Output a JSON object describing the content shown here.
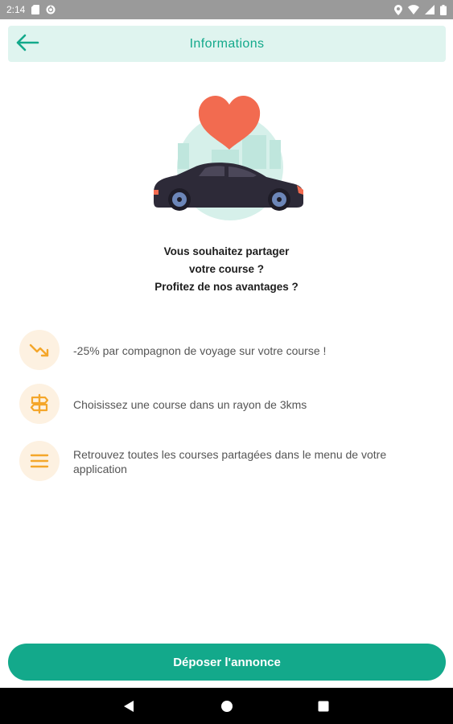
{
  "status_bar": {
    "time": "2:14",
    "left_icons": [
      "sd-card-icon",
      "sync-icon"
    ],
    "right_icons": [
      "location-icon",
      "wifi-icon",
      "signal-icon",
      "battery-icon"
    ]
  },
  "header": {
    "title": "Informations",
    "back_icon": "arrow-left-icon"
  },
  "illustration": {
    "icons": [
      "heart-icon",
      "car-icon"
    ],
    "colors": {
      "heart": "#f26b50",
      "car": "#2d2a38",
      "background_circle": "#d6f0ea"
    }
  },
  "intro": {
    "line1": "Vous souhaitez partager",
    "line2": "votre course ?",
    "line3": "Profitez de nos avantages ?"
  },
  "features": [
    {
      "icon": "trending-down-icon",
      "text": "-25% par compagnon de voyage sur votre course !"
    },
    {
      "icon": "signpost-icon",
      "text": "Choisissez une course dans un rayon de 3kms"
    },
    {
      "icon": "menu-icon",
      "text": "Retrouvez toutes les courses partagées dans le menu de votre application"
    }
  ],
  "cta": {
    "label": "Déposer l'annonce"
  },
  "nav_bar": {
    "icons": [
      "back-triangle-icon",
      "home-circle-icon",
      "recents-square-icon"
    ]
  },
  "colors": {
    "accent": "#13a98b",
    "header_bg": "#dff4ef",
    "icon_orange": "#f4a62a",
    "icon_bg": "#fdf1e1",
    "status_bar": "#9a9a9a",
    "nav_bar": "#000000"
  }
}
